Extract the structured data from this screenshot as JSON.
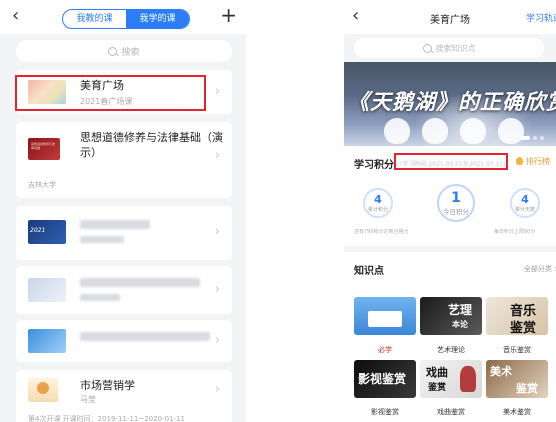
{
  "left": {
    "tabs": [
      "我教的课",
      "我学的课"
    ],
    "active_tab": 1,
    "search_placeholder": "搜索",
    "courses": [
      {
        "title": "美育广场",
        "subtitle": "2021春广场课"
      },
      {
        "title": "思想道德修养与法律基础（演示）",
        "subtitle": "吉林大学"
      },
      {
        "title": "",
        "subtitle": ""
      },
      {
        "title": "",
        "subtitle": ""
      },
      {
        "title": "",
        "subtitle": ""
      },
      {
        "title": "市场营销学",
        "subtitle": "马莹",
        "footer": "第4次开课   开课时间：2019-11-11~2020-01-11"
      }
    ],
    "thumb_texts": {
      "course2": "思想道德修养与法律基础",
      "course3": "2021"
    }
  },
  "right": {
    "title": "美育广场",
    "link": "学习轨迹",
    "search_placeholder": "搜索知识点",
    "banner_text": "《天鹅湖》的正确欣赏方式",
    "score": {
      "label": "学习积分",
      "range": "(学习时间:2021.03.01至2021.07.11)",
      "rank": "排行榜",
      "left": {
        "value": "4",
        "caption": "累计积分"
      },
      "center": {
        "value": "1",
        "caption": "今日积分"
      },
      "right": {
        "value": "4",
        "caption": "累计天数"
      },
      "note_left": "还有796积分达到合格分",
      "note_right": "每日积分上限80分"
    },
    "knowledge": {
      "title": "知识点",
      "all_link": "全部分类 >",
      "tiles": [
        {
          "label": "必学",
          "highlight": true
        },
        {
          "label": "艺术理论",
          "overlay": [
            "艺理",
            "本论"
          ]
        },
        {
          "label": "音乐鉴赏",
          "overlay": [
            "音乐",
            "鉴赏"
          ]
        },
        {
          "label": "影视鉴赏",
          "overlay": [
            "影视鉴赏"
          ]
        },
        {
          "label": "戏曲鉴赏",
          "overlay": [
            "戏曲",
            "鉴赏"
          ]
        },
        {
          "label": "美术鉴赏",
          "overlay": [
            "美术",
            "鉴赏"
          ]
        }
      ]
    }
  }
}
